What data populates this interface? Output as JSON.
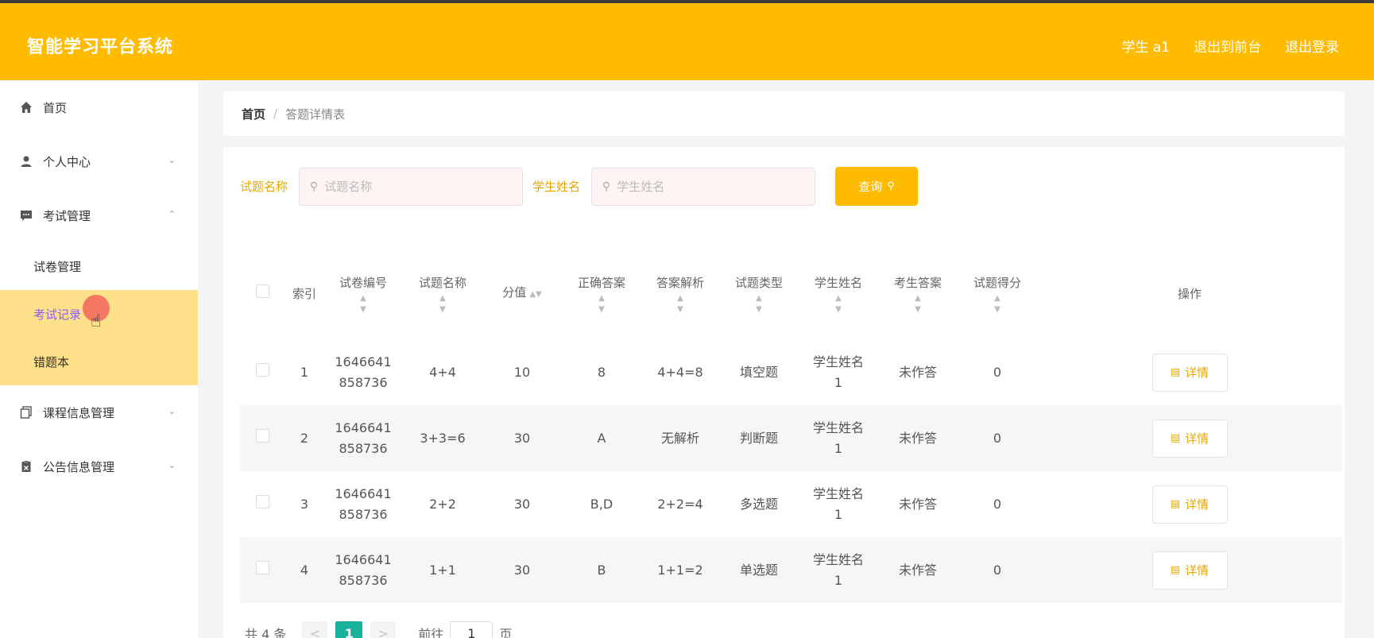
{
  "header": {
    "brand": "智能学习平台系统",
    "links": [
      "学生 a1",
      "退出到前台",
      "退出登录"
    ]
  },
  "sidebar": {
    "items": [
      {
        "label": "首页",
        "icon": "home-icon"
      },
      {
        "label": "个人中心",
        "icon": "user-icon"
      },
      {
        "label": "考试管理",
        "icon": "chat-icon"
      },
      {
        "label": "课程信息管理",
        "icon": "copy-icon"
      },
      {
        "label": "公告信息管理",
        "icon": "clipboard-icon"
      }
    ],
    "exam_sub": [
      "试卷管理",
      "考试记录",
      "错题本"
    ]
  },
  "breadcrumb": {
    "home": "首页",
    "sep": "/",
    "current": "答题详情表"
  },
  "search": {
    "label1": "试题名称",
    "placeholder1": "试题名称",
    "label2": "学生姓名",
    "placeholder2": "学生姓名",
    "button": "查询"
  },
  "table": {
    "headers": [
      "索引",
      "试卷编号",
      "试题名称",
      "分值",
      "正确答案",
      "答案解析",
      "试题类型",
      "学生姓名",
      "考生答案",
      "试题得分",
      "操作"
    ],
    "action_label": "详情",
    "rows": [
      {
        "idx": "1",
        "paper1": "1646641",
        "paper2": "858736",
        "name": "4+4",
        "score": "10",
        "answer": "8",
        "analysis": "4+4=8",
        "type": "填空题",
        "student1": "学生姓名",
        "student2": "1",
        "stu_answer": "未作答",
        "got": "0"
      },
      {
        "idx": "2",
        "paper1": "1646641",
        "paper2": "858736",
        "name": "3+3=6",
        "score": "30",
        "answer": "A",
        "analysis": "无解析",
        "type": "判断题",
        "student1": "学生姓名",
        "student2": "1",
        "stu_answer": "未作答",
        "got": "0"
      },
      {
        "idx": "3",
        "paper1": "1646641",
        "paper2": "858736",
        "name": "2+2",
        "score": "30",
        "answer": "B,D",
        "analysis": "2+2=4",
        "type": "多选题",
        "student1": "学生姓名",
        "student2": "1",
        "stu_answer": "未作答",
        "got": "0"
      },
      {
        "idx": "4",
        "paper1": "1646641",
        "paper2": "858736",
        "name": "1+1",
        "score": "30",
        "answer": "B",
        "analysis": "1+1=2",
        "type": "单选题",
        "student1": "学生姓名",
        "student2": "1",
        "stu_answer": "未作答",
        "got": "0"
      }
    ]
  },
  "pagination": {
    "total": "共 4 条",
    "prev": "<",
    "page": "1",
    "next": ">",
    "goto": "前往",
    "goto_value": "1",
    "unit": "页"
  },
  "colors": {
    "accent": "#ffbb00",
    "submenu_bg": "#ffe08a",
    "active_text": "#8b5cf6",
    "page_active": "#19b39c"
  }
}
